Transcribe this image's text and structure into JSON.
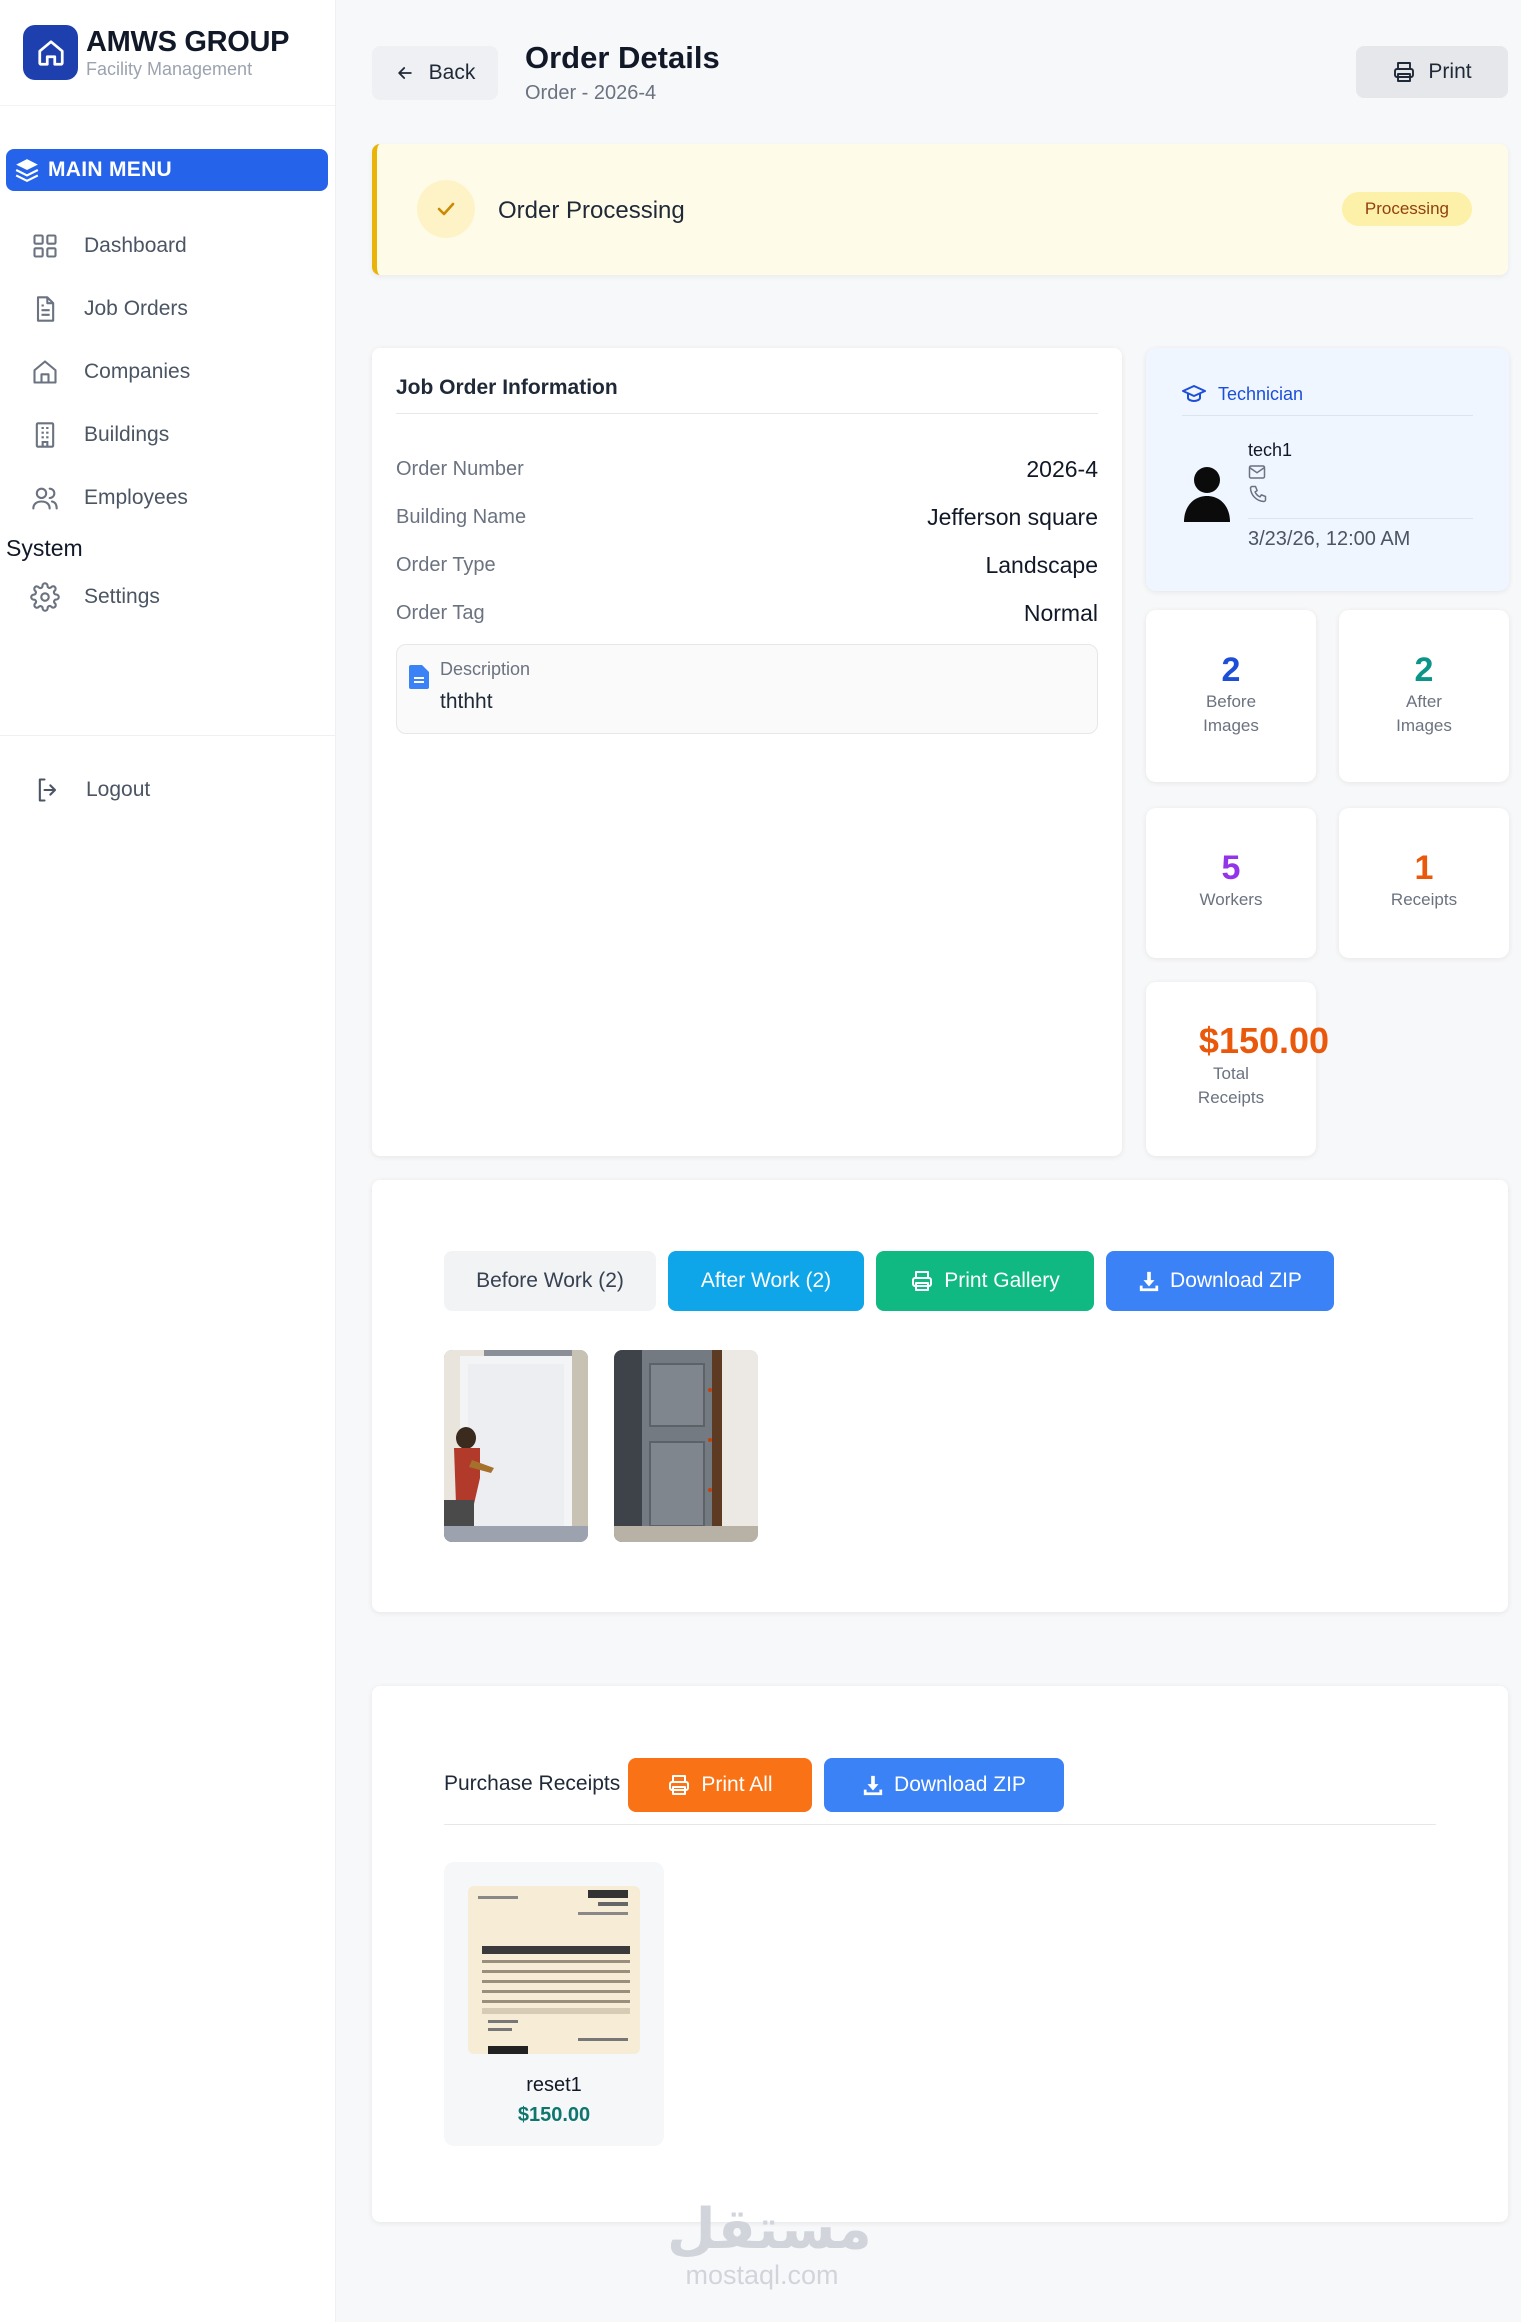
{
  "brand": {
    "title": "AMWS GROUP",
    "subtitle": "Facility Management",
    "color": "#1e40af"
  },
  "sidebar": {
    "menu_heading": "MAIN MENU",
    "items": [
      {
        "label": "Dashboard",
        "icon": "grid-icon"
      },
      {
        "label": "Job Orders",
        "icon": "document-icon"
      },
      {
        "label": "Companies",
        "icon": "home-icon"
      },
      {
        "label": "Buildings",
        "icon": "building-icon"
      },
      {
        "label": "Employees",
        "icon": "users-icon"
      }
    ],
    "system_label": "System",
    "settings_label": "Settings",
    "logout_label": "Logout"
  },
  "header": {
    "back_label": "Back",
    "title": "Order Details",
    "subtitle": "Order - 2026-4",
    "print_label": "Print"
  },
  "status": {
    "title": "Order Processing",
    "badge": "Processing",
    "accent": "#eab308"
  },
  "info": {
    "heading": "Job Order Information",
    "rows": [
      {
        "label": "Order Number",
        "value": "2026-4"
      },
      {
        "label": "Building Name",
        "value": "Jefferson square"
      },
      {
        "label": "Order Type",
        "value": "Landscape"
      },
      {
        "label": "Order Tag",
        "value": "Normal"
      }
    ],
    "description_label": "Description",
    "description": "ththht"
  },
  "technician": {
    "heading": "Technician",
    "name": "tech1",
    "date": "3/23/26, 12:00 AM"
  },
  "stats": {
    "before": {
      "value": "2",
      "label1": "Before",
      "label2": "Images",
      "color": "#1d4ed8"
    },
    "after": {
      "value": "2",
      "label1": "After",
      "label2": "Images",
      "color": "#0d9488"
    },
    "workers": {
      "value": "5",
      "label": "Workers",
      "color": "#9333ea"
    },
    "receipts": {
      "value": "1",
      "label": "Receipts",
      "color": "#ea580c"
    },
    "total": {
      "value": "$150.00",
      "label1": "Total",
      "label2": "Receipts",
      "color": "#ea580c"
    }
  },
  "gallery": {
    "tab_before": "Before Work (2)",
    "tab_after": "After Work (2)",
    "print_label": "Print Gallery",
    "download_label": "Download ZIP"
  },
  "receipts": {
    "title": "Purchase Receipts",
    "print_all_label": "Print All",
    "download_label": "Download ZIP",
    "items": [
      {
        "name": "reset1",
        "amount": "$150.00"
      }
    ]
  },
  "watermark": {
    "arabic": "مستقل",
    "latin": "mostaql.com"
  }
}
